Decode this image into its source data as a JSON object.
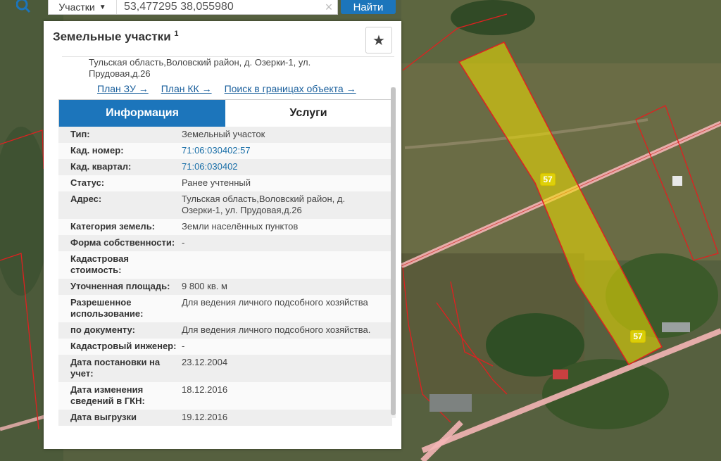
{
  "search": {
    "type_label": "Участки",
    "query": "53,477295 38,055980",
    "clear_symbol": "×",
    "find_label": "Найти"
  },
  "panel": {
    "title": "Земельные участки",
    "title_sup": "1",
    "address": "Тульская область,Воловский район, д. Озерки-1, ул. Прудовая,д.26",
    "links": {
      "plan_zu": "План ЗУ →",
      "plan_kk": "План КК →",
      "search_bounds": "Поиск в границах объекта →"
    },
    "tabs": {
      "info": "Информация",
      "services": "Услуги"
    },
    "properties": [
      {
        "label": "Тип:",
        "value": "Земельный участок"
      },
      {
        "label": "Кад. номер:",
        "value": "71:06:030402:57",
        "link": true
      },
      {
        "label": "Кад. квартал:",
        "value": "71:06:030402",
        "link": true
      },
      {
        "label": "Статус:",
        "value": "Ранее учтенный"
      },
      {
        "label": "Адрес:",
        "value": "Тульская область,Воловский район, д. Озерки-1, ул. Прудовая,д.26"
      },
      {
        "label": "Категория земель:",
        "value": "Земли населённых пунктов"
      },
      {
        "label": "Форма собственности:",
        "value": "-"
      },
      {
        "label": "Кадастровая стоимость:",
        "value": ""
      },
      {
        "label": "Уточненная площадь:",
        "value": "9 800 кв. м"
      },
      {
        "label": "Разрешенное использование:",
        "value": "Для ведения личного подсобного хозяйства"
      },
      {
        "label": "по документу:",
        "value": "Для ведения личного подсобного хозяйства."
      },
      {
        "label": "Кадастровый инженер:",
        "value": "-"
      },
      {
        "label": "Дата постановки на учет:",
        "value": "23.12.2004"
      },
      {
        "label": "Дата изменения сведений в ГКН:",
        "value": "18.12.2016"
      },
      {
        "label": "Дата выгрузки",
        "value": "19.12.2016"
      }
    ]
  },
  "map": {
    "parcel_labels": [
      "57",
      "57"
    ],
    "colors": {
      "parcel_fill": "#f0e000",
      "parcel_stroke": "#e02020",
      "road": "#f4b5b5"
    }
  }
}
